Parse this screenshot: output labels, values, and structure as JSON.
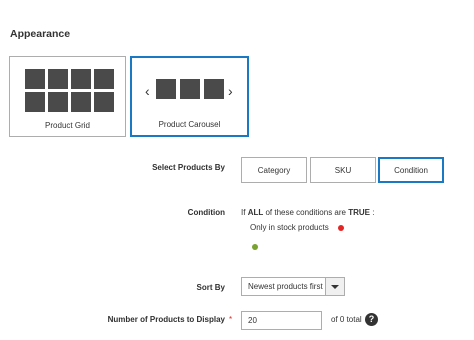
{
  "section": {
    "title": "Appearance"
  },
  "appearance": {
    "options": [
      {
        "label": "Product Grid",
        "selected": false
      },
      {
        "label": "Product Carousel",
        "selected": true
      }
    ]
  },
  "select_products_by": {
    "label": "Select Products By",
    "options": [
      "Category",
      "SKU",
      "Condition"
    ],
    "selected": "Condition"
  },
  "condition": {
    "label": "Condition",
    "prefix": "If",
    "aggregator": "ALL",
    "middle": "of these conditions are",
    "value": "TRUE",
    "suffix": ":",
    "items": [
      "Only in stock products"
    ]
  },
  "sort_by": {
    "label": "Sort By",
    "value": "Newest products first"
  },
  "num_products": {
    "label": "Number of Products to Display",
    "required_mark": "*",
    "value": "20",
    "total_text": "of 0 total",
    "help_glyph": "?"
  },
  "colors": {
    "accent": "#1979c3",
    "tile_dark": "#4a4a4a",
    "remove": "#e22626",
    "add": "#79a22e"
  }
}
